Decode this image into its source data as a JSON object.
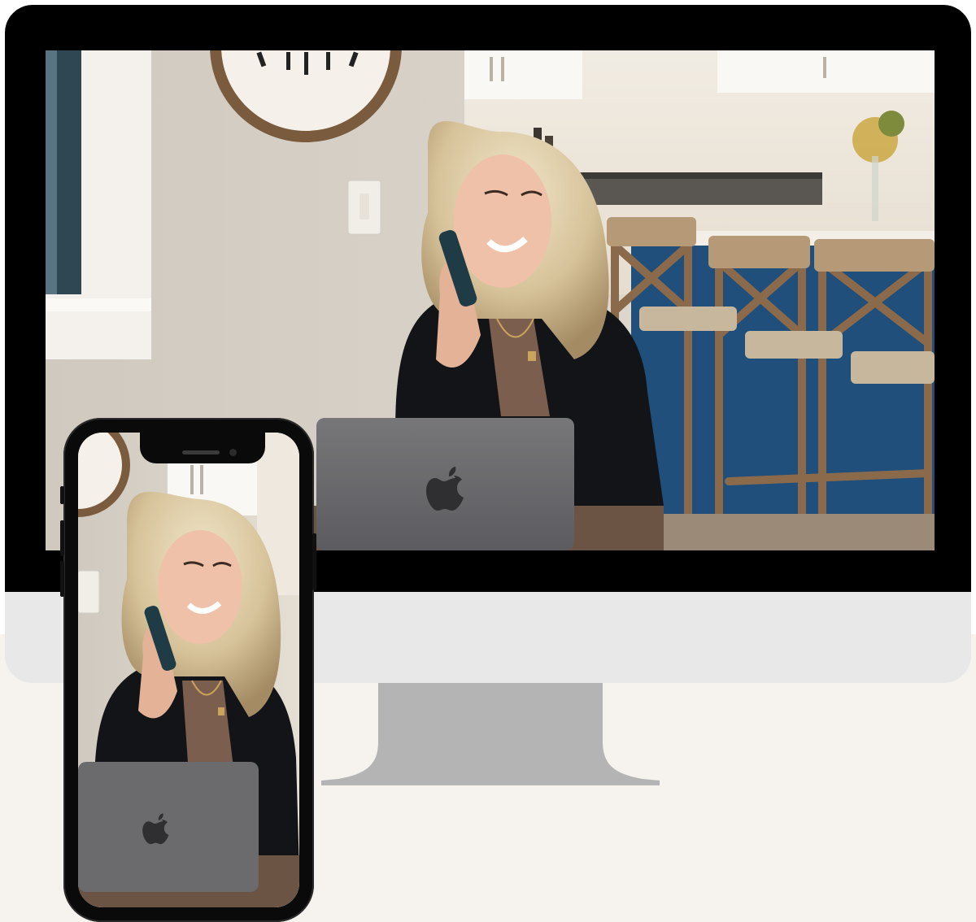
{
  "mockup": {
    "devices": [
      "desktop-monitor",
      "smartphone"
    ],
    "photo_subject": "woman-on-phone-with-laptop"
  },
  "colors": {
    "page_background": "#f6f3ee",
    "bezel": "#000000",
    "monitor_chin": "#e8e8e8",
    "monitor_stand": "#b4b4b4",
    "phone_frame": "#0a0a0a",
    "wall": "#d8d2c8",
    "kitchen_island_blue": "#1f4f7a",
    "laptop_gray": "#6b6b6e",
    "wood": "#8a6a4a"
  },
  "icons": [
    "apple-logo-icon",
    "wall-clock-icon",
    "light-switch-icon",
    "bar-stool-icon"
  ]
}
